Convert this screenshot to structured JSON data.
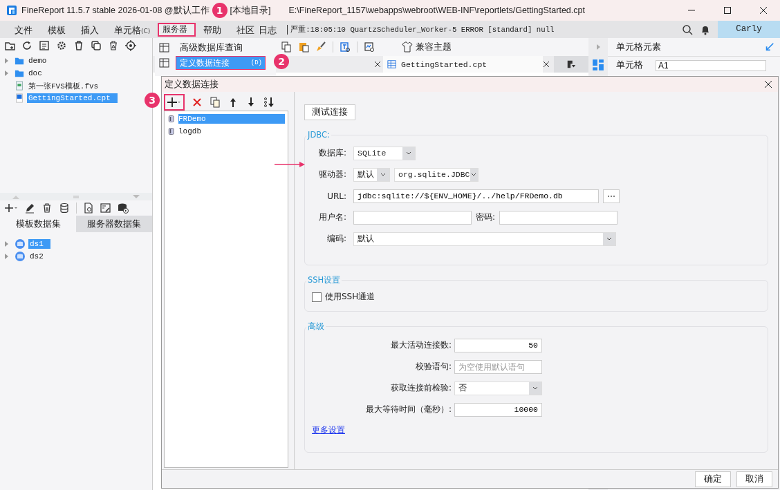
{
  "window": {
    "title": "FineReport 11.5.7 stable 2026-01-08 @默认工作",
    "title_rest": "[本地目录]",
    "path": "E:\\FineReport_1157\\webapps\\webroot\\WEB-INF\\reportlets/GettingStarted.cpt"
  },
  "menu_bar": {
    "items": [
      {
        "label": "文件",
        "selected": false
      },
      {
        "label": "模板",
        "selected": false
      },
      {
        "label": "插入",
        "selected": false
      },
      {
        "label": "单元格",
        "shortcut": "(C)",
        "selected": false
      },
      {
        "label": "服务器",
        "selected": true
      },
      {
        "label": "帮助",
        "selected": false
      },
      {
        "label": "社区",
        "selected": false
      },
      {
        "label": "日志",
        "selected": false
      }
    ],
    "log": "严重:18:05:10 QuartzScheduler_Worker-5 ERROR [standard] null",
    "user": "Carly"
  },
  "file_tree": [
    {
      "label": "demo",
      "kind": "folder",
      "selected": false
    },
    {
      "label": "doc",
      "kind": "folder",
      "selected": false
    },
    {
      "label": "第一张FVS模板.fvs",
      "kind": "form",
      "selected": false
    },
    {
      "label": "GettingStarted.cpt",
      "kind": "report",
      "selected": true
    }
  ],
  "dataset_tabs": [
    {
      "label": "模板数据集",
      "selected": true
    },
    {
      "label": "服务器数据集",
      "selected": false
    }
  ],
  "datasets": [
    {
      "label": "ds1",
      "selected": true
    },
    {
      "label": "ds2",
      "selected": false
    }
  ],
  "server_menu": [
    {
      "label": "高级数据库查询",
      "selected": false
    },
    {
      "label": "定义数据连接",
      "shortcut": "(D)",
      "selected": true
    }
  ],
  "toolbar": {
    "theme": "兼容主题"
  },
  "editor_tab": {
    "label": "GettingStarted.cpt"
  },
  "properties": {
    "title": "单元格元素",
    "cell_label": "单元格",
    "cell_value": "A1"
  },
  "dialog": {
    "title": "定义数据连接",
    "connections": [
      {
        "label": "FRDemo",
        "selected": true
      },
      {
        "label": "logdb",
        "selected": false
      }
    ],
    "test_button": "测试连接",
    "jdbc": {
      "legend": "JDBC:",
      "database_label": "数据库:",
      "database": "SQLite",
      "driver_label": "驱动器:",
      "driver_mode": "默认",
      "driver": "org.sqlite.JDBC",
      "url_label": "URL:",
      "url": "jdbc:sqlite://${ENV_HOME}/../help/FRDemo.db",
      "user_label": "用户名:",
      "password_label": "密码:",
      "encoding_label": "编码:",
      "encoding": "默认"
    },
    "ssh": {
      "legend": "SSH设置",
      "label": "使用SSH通道",
      "checked": false
    },
    "advanced": {
      "legend": "高级",
      "rows": [
        {
          "kind": "input",
          "label": "最大活动连接数:",
          "value": "50"
        },
        {
          "kind": "input",
          "label": "校验语句:",
          "placeholder": "为空使用默认语句"
        },
        {
          "kind": "select",
          "label": "获取连接前检验:",
          "value": "否"
        },
        {
          "kind": "input",
          "label": "最大等待时间（毫秒）:",
          "value": "10000"
        }
      ],
      "more_link": "更多设置"
    },
    "buttons": [
      "确定",
      "取消"
    ]
  },
  "annotations": [
    {
      "number": "1"
    },
    {
      "number": "2"
    },
    {
      "number": "3"
    }
  ]
}
